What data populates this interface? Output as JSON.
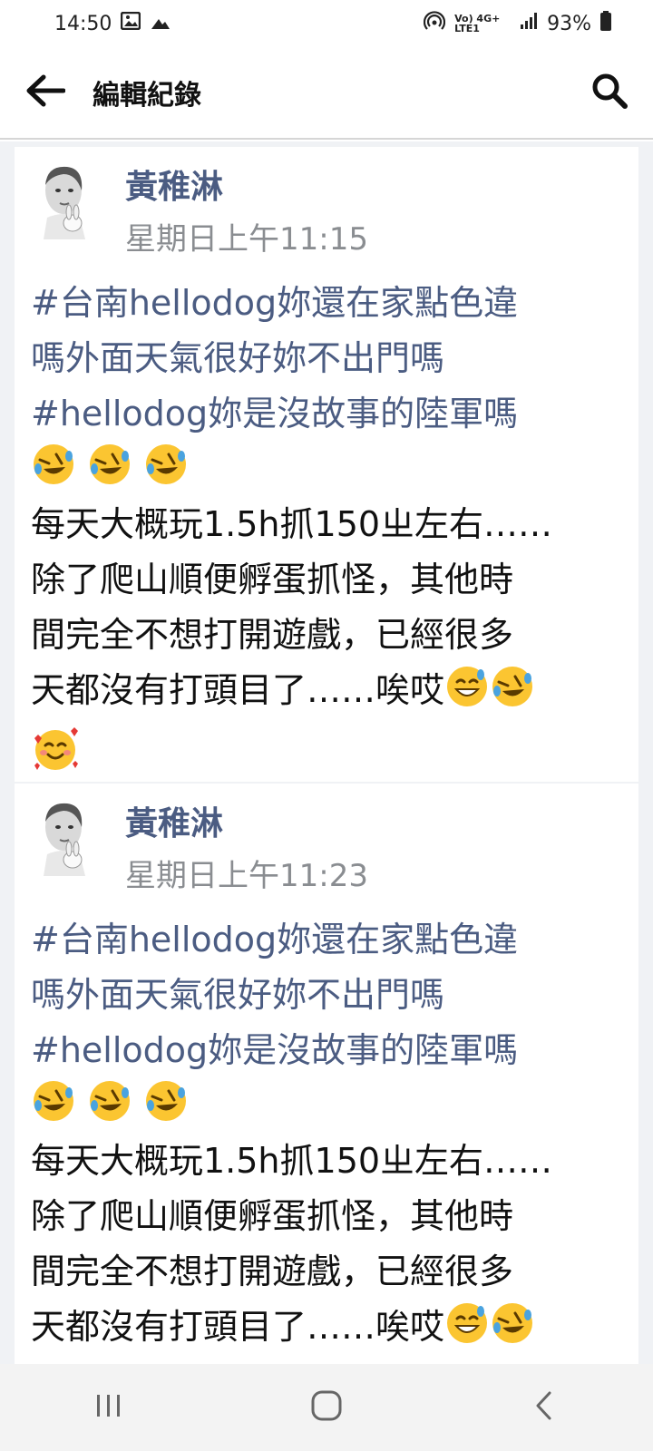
{
  "status_bar": {
    "time": "14:50",
    "network_label": "Vo) 4G+ LTE1",
    "battery": "93%",
    "icons": [
      "image-icon",
      "cloud-icon",
      "hotspot-icon",
      "signal-icon",
      "battery-icon"
    ]
  },
  "app_bar": {
    "title": "編輯紀錄",
    "icons": {
      "back": "back-arrow-icon",
      "search": "search-icon"
    }
  },
  "posts": [
    {
      "author": "黃稚淋",
      "time": "星期日上午11:15",
      "hashtag_line1": "#台南hellodog妳還在家點色違",
      "hashtag_line2": "嗎外面天氣很好妳不出門嗎",
      "hashtag_line3": "#hellodog妳是沒故事的陸軍嗎",
      "body_line1": "每天大概玩1.5h抓150ㄓ左右……",
      "body_line2": "除了爬山順便孵蛋抓怪，其他時",
      "body_line3": "間完全不想打開遊戲，已經很多",
      "body_line4": "天都沒有打頭目了……唉哎"
    },
    {
      "author": "黃稚淋",
      "time": "星期日上午11:23",
      "hashtag_line1": "#台南hellodog妳還在家點色違",
      "hashtag_line2": "嗎外面天氣很好妳不出門嗎",
      "hashtag_line3": "#hellodog妳是沒故事的陸軍嗎",
      "body_line1": "每天大概玩1.5h抓150ㄓ左右……",
      "body_line2": "除了爬山順便孵蛋抓怪，其他時",
      "body_line3": "間完全不想打開遊戲，已經很多",
      "body_line4": "天都沒有打頭目了……唉哎"
    }
  ],
  "colors": {
    "author": "#4b5c82",
    "hashtag": "#4b5c82",
    "timestamp": "#8a8d91",
    "background": "#f0f2f5"
  },
  "nav_bar": {
    "icons": [
      "recent-apps-icon",
      "home-icon",
      "back-icon"
    ]
  }
}
